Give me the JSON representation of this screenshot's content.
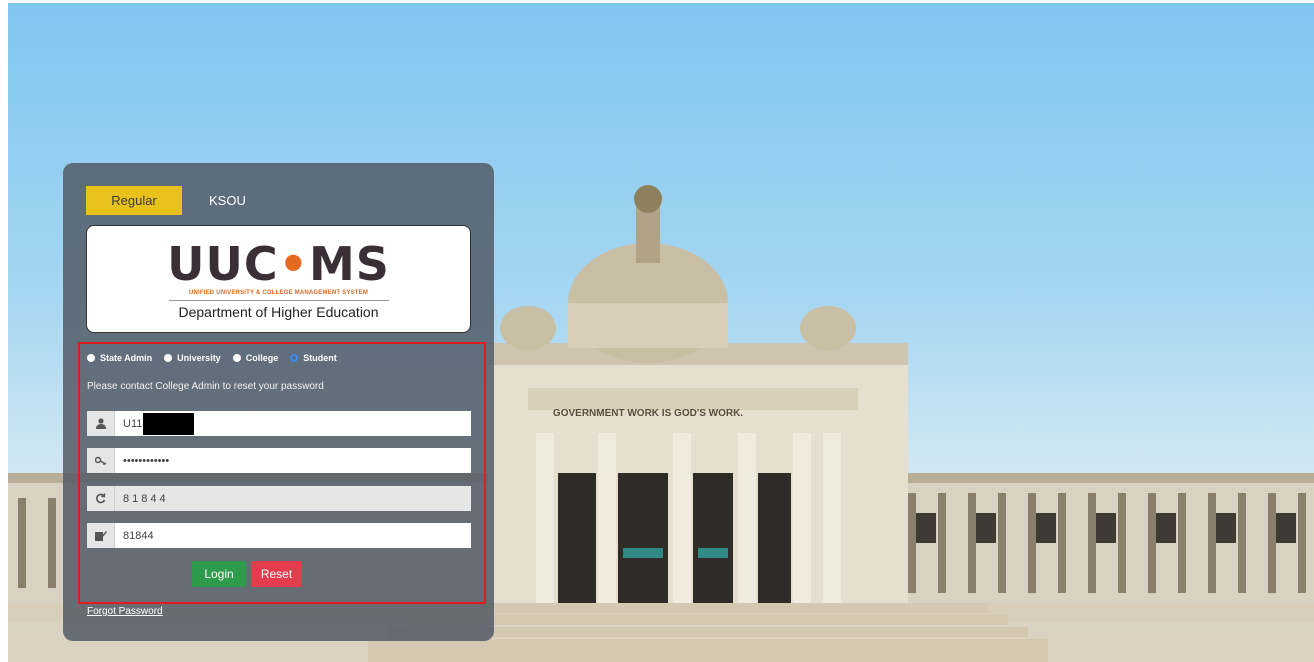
{
  "tabs": [
    {
      "label": "Regular",
      "active": true
    },
    {
      "label": "KSOU",
      "active": false
    }
  ],
  "logo": {
    "title": "UUCMS",
    "subtitle": "UNIFIED UNIVERSITY & COLLEGE MANAGEMENT SYSTEM",
    "department": "Department of Higher Education"
  },
  "roles": {
    "options": [
      {
        "label": "State Admin",
        "selected": false
      },
      {
        "label": "University",
        "selected": false
      },
      {
        "label": "College",
        "selected": false
      },
      {
        "label": "Student",
        "selected": true
      }
    ]
  },
  "note": "Please contact College Admin to reset your password",
  "form": {
    "username_value": "U11        485",
    "password_value": "••••••••••••",
    "captcha_value": "81844",
    "captcha_input_value": "81844"
  },
  "buttons": {
    "login": "Login",
    "reset": "Reset"
  },
  "forgot_password": "Forgot Password",
  "background": {
    "inscription": "GOVERNMENT WORK IS GOD'S WORK."
  },
  "colors": {
    "active_tab": "#e8c21a",
    "login_button": "#2e9a4c",
    "reset_button": "#e33c4d",
    "highlight_border": "#e01c1c",
    "radio_selected": "#3b8cf5"
  },
  "icons": [
    "user-icon",
    "key-icon",
    "refresh-icon",
    "edit-icon"
  ]
}
